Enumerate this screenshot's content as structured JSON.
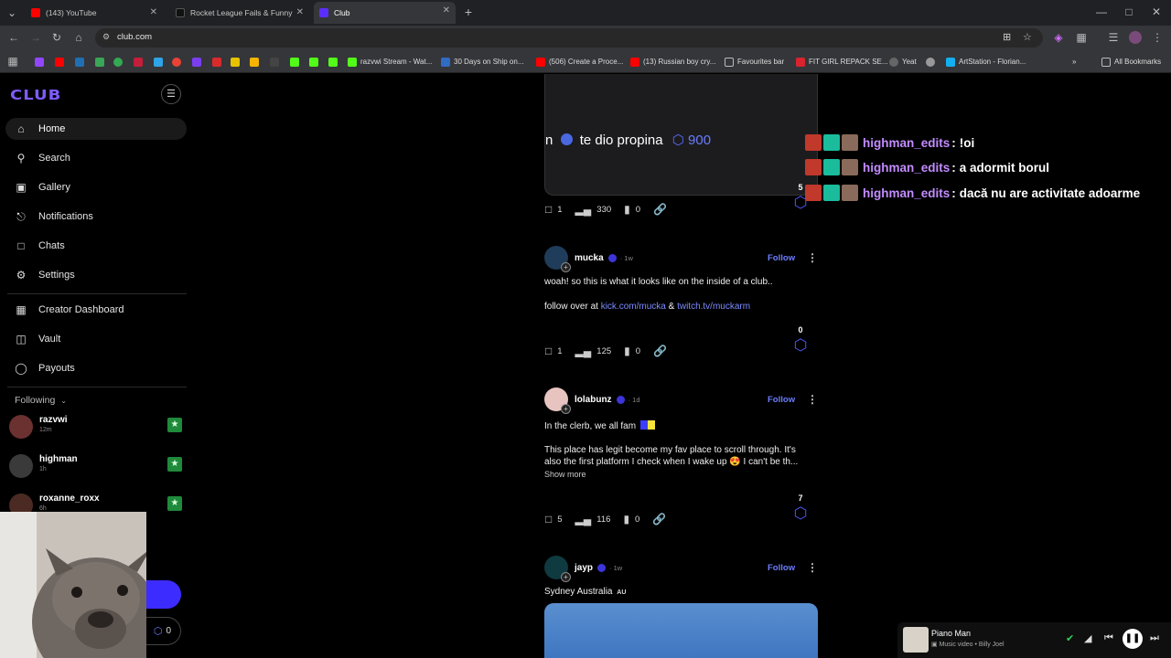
{
  "browser": {
    "tabs": [
      {
        "title": "(143) YouTube",
        "favicon_color": "#ff0000"
      },
      {
        "title": "Rocket League Fails & Funny M",
        "favicon_color": "#111111"
      },
      {
        "title": "Club",
        "favicon_color": "#5b2eff"
      }
    ],
    "new_tab": "+",
    "url": "club.com",
    "bookmarks": [
      {
        "label": "razvwi Stream - Wat...",
        "color": "#53fc18"
      },
      {
        "label": "30 Days on Ship on...",
        "color": "#2f6cc4"
      },
      {
        "label": "(506) Create a Proce...",
        "color": "#ff0000"
      },
      {
        "label": "(13) Russian boy cry...",
        "color": "#ff0000"
      },
      {
        "label": "Favourites bar",
        "color": "#bbbbbb"
      },
      {
        "label": "FIT GIRL REPACK SE...",
        "color": "#d9232d"
      },
      {
        "label": "Yeat",
        "color": "#666666"
      },
      {
        "label": "ArtStation - Florian...",
        "color": "#13aff0"
      }
    ],
    "all_bookmarks": "All Bookmarks"
  },
  "sidebar": {
    "logo": "CLUB",
    "nav": [
      {
        "label": "Home",
        "icon": "home-icon"
      },
      {
        "label": "Search",
        "icon": "search-icon"
      },
      {
        "label": "Gallery",
        "icon": "gallery-icon"
      },
      {
        "label": "Notifications",
        "icon": "bell-icon"
      },
      {
        "label": "Chats",
        "icon": "chat-icon"
      },
      {
        "label": "Settings",
        "icon": "gear-icon"
      }
    ],
    "creator_nav": [
      {
        "label": "Creator Dashboard",
        "icon": "dashboard-icon"
      },
      {
        "label": "Vault",
        "icon": "vault-icon"
      },
      {
        "label": "Payouts",
        "icon": "payouts-icon"
      }
    ],
    "following_label": "Following",
    "following": [
      {
        "name": "razvwi",
        "time": "12m"
      },
      {
        "name": "highman",
        "time": "1h"
      },
      {
        "name": "roxanne_roxx",
        "time": "6h"
      }
    ],
    "points": "0"
  },
  "feed": {
    "top_post": {
      "caption": "te dio propina",
      "tip_amount": "900",
      "comments": "1",
      "views": "330",
      "saves": "0",
      "points": "5"
    },
    "posts": [
      {
        "user": "mucka",
        "ago": "1w",
        "follow": "Follow",
        "text1": "woah! so this is what it looks like on the inside of a club..",
        "text2_prefix": "follow over at ",
        "link1": "kick.com/mucka",
        "amp": " & ",
        "link2": "twitch.tv/muckarm",
        "comments": "1",
        "views": "125",
        "saves": "0",
        "points": "0"
      },
      {
        "user": "lolabunz",
        "ago": "1d",
        "follow": "Follow",
        "text1": "In the clerb, we all fam",
        "text2": "This place has legit become my fav place to scroll through. It's",
        "text3": "also the first platform I check when I wake up 😍 I can't be th...",
        "show_more": "Show more",
        "comments": "5",
        "views": "116",
        "saves": "0",
        "points": "7"
      },
      {
        "user": "jayp",
        "ago": "1w",
        "follow": "Follow",
        "text1": "Sydney Australia",
        "flag": "AU"
      }
    ]
  },
  "chat_overlay": [
    {
      "user": "highman_edits",
      "message": "!oi"
    },
    {
      "user": "highman_edits",
      "message": "a adormit borul"
    },
    {
      "user": "highman_edits",
      "message": "dacă nu are activitate adoarme"
    }
  ],
  "player": {
    "song": "Piano Man",
    "type": "Music video",
    "artist": "Billy Joel",
    "separator": " • "
  }
}
